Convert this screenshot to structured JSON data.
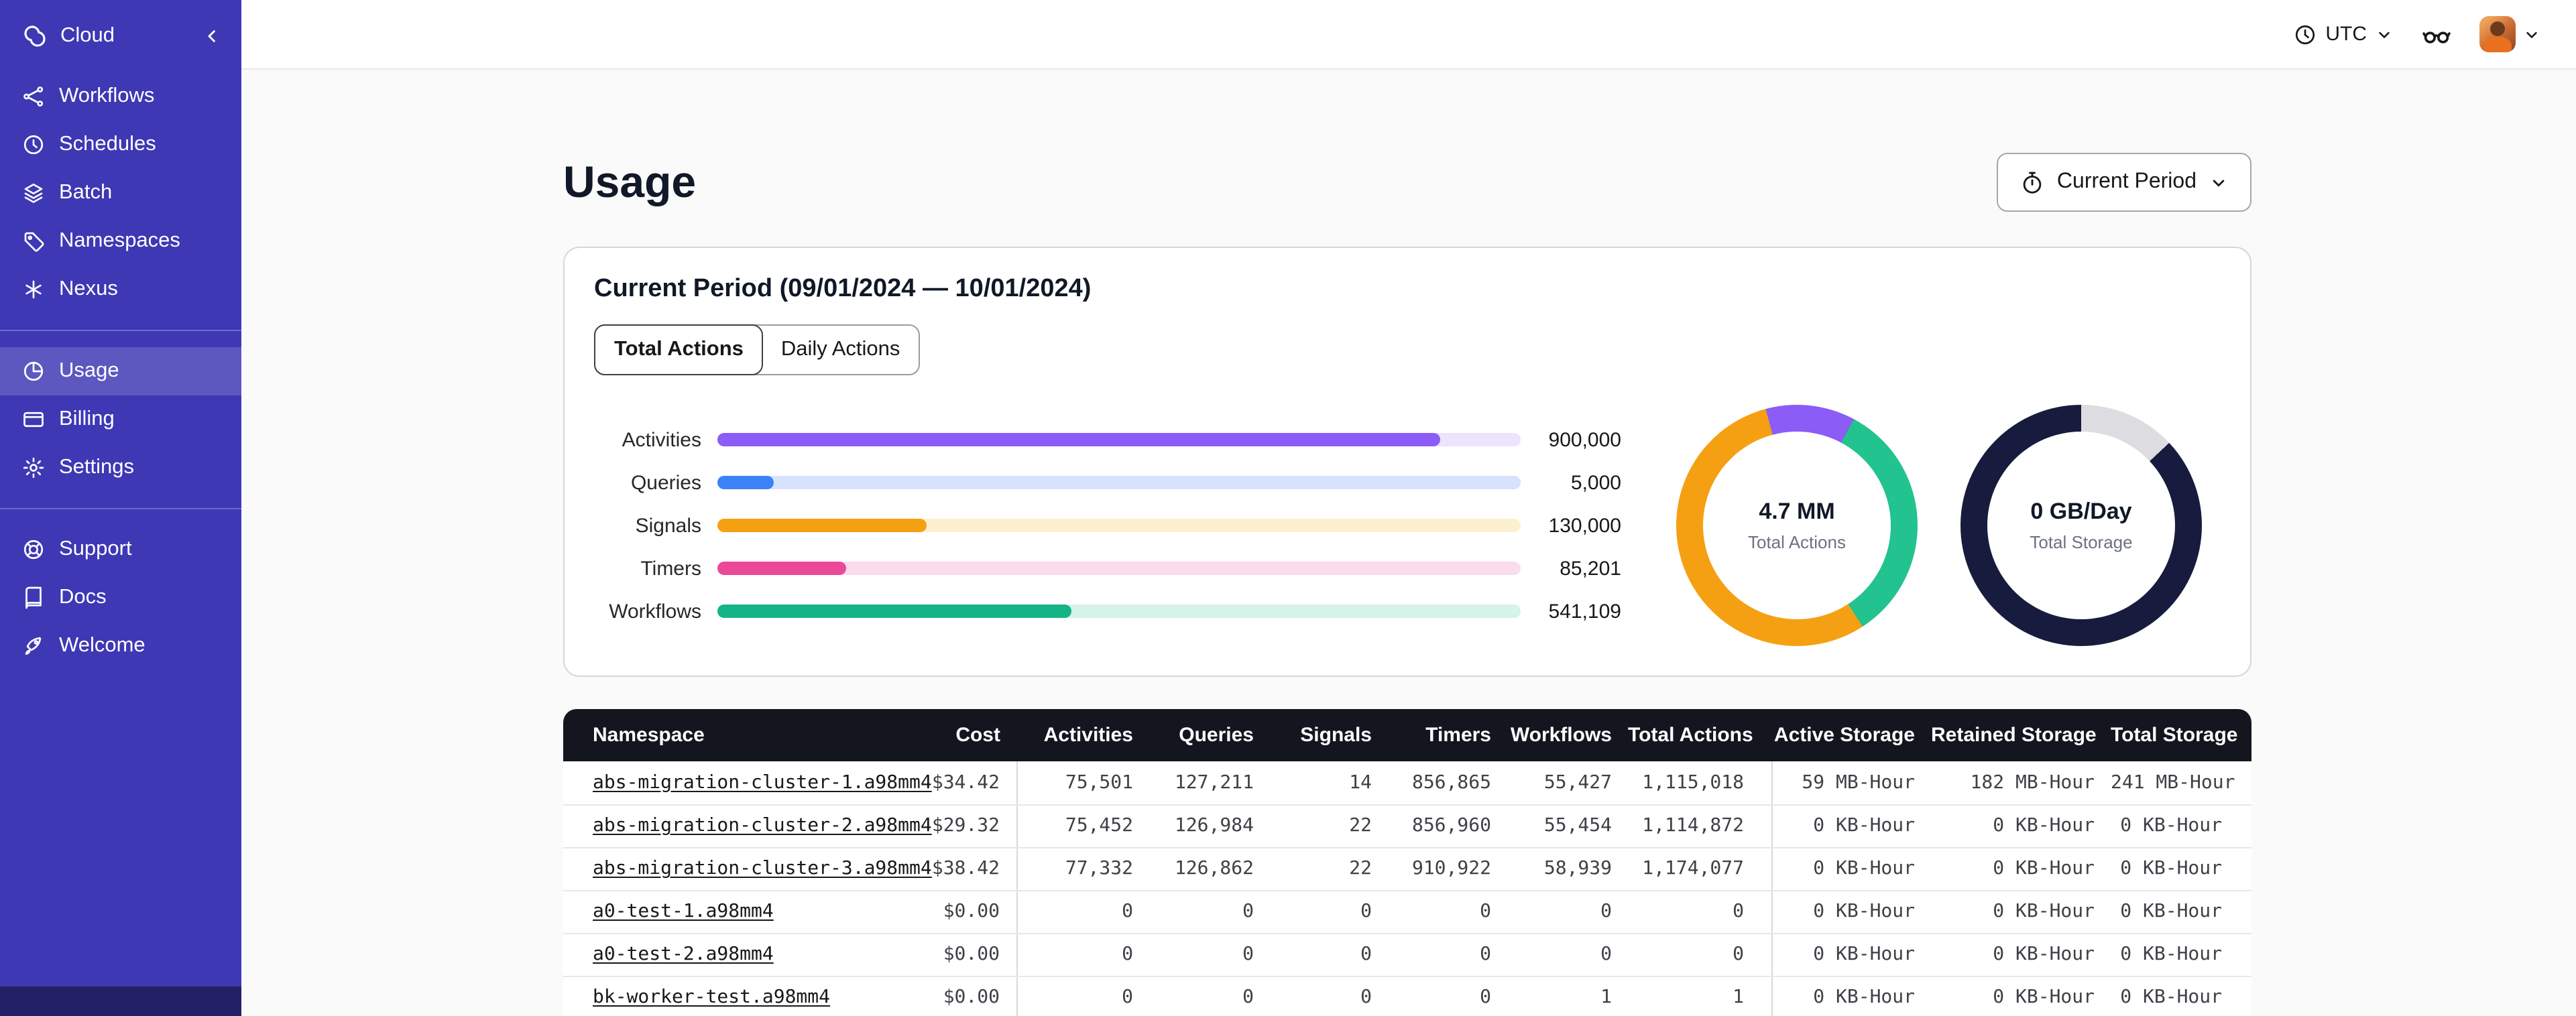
{
  "colors": {
    "sidebar": "#3e38b4",
    "sidebar_footer": "#232066",
    "table_header": "#14161f"
  },
  "sidebar": {
    "brand": {
      "label": "Cloud",
      "icon": "temporal-logo-icon"
    },
    "nav_main": [
      {
        "label": "Workflows",
        "icon": "workflows-icon"
      },
      {
        "label": "Schedules",
        "icon": "schedules-icon"
      },
      {
        "label": "Batch",
        "icon": "batch-icon"
      },
      {
        "label": "Namespaces",
        "icon": "namespaces-icon"
      },
      {
        "label": "Nexus",
        "icon": "nexus-icon"
      }
    ],
    "nav_account": [
      {
        "label": "Usage",
        "icon": "usage-icon",
        "active": true
      },
      {
        "label": "Billing",
        "icon": "billing-icon",
        "active": false
      },
      {
        "label": "Settings",
        "icon": "settings-icon",
        "active": false
      }
    ],
    "nav_help": [
      {
        "label": "Support",
        "icon": "support-icon"
      },
      {
        "label": "Docs",
        "icon": "docs-icon"
      },
      {
        "label": "Welcome",
        "icon": "welcome-icon"
      }
    ]
  },
  "topbar": {
    "timezone": "UTC"
  },
  "page": {
    "title": "Usage",
    "period_selector": "Current Period"
  },
  "card": {
    "title": "Current Period (09/01/2024 — 10/01/2024)",
    "tabs": [
      {
        "label": "Total Actions",
        "active": true
      },
      {
        "label": "Daily Actions",
        "active": false
      }
    ]
  },
  "chart_data": [
    {
      "type": "bar",
      "orientation": "horizontal",
      "categories": [
        "Activities",
        "Queries",
        "Signals",
        "Timers",
        "Workflows"
      ],
      "values": [
        900000,
        5000,
        130000,
        85201,
        541109
      ],
      "value_labels": [
        "900,000",
        "5,000",
        "130,000",
        "85,201",
        "541,109"
      ],
      "fill_percents": [
        90,
        7,
        26,
        16,
        44
      ],
      "colors": [
        "#8b5cf6",
        "#3b82f6",
        "#f5a013",
        "#ec4899",
        "#14b487"
      ],
      "track_colors": [
        "#ece4fd",
        "#d7e3fd",
        "#fdf0cf",
        "#fbdcee",
        "#d5f3e6"
      ]
    },
    {
      "type": "pie",
      "title": "Total Actions donut",
      "center_value": "4.7 MM",
      "center_label": "Total Actions",
      "slices": [
        {
          "name": "purple-segment",
          "percent": 12,
          "color": "#8b5cf6"
        },
        {
          "name": "green-segment",
          "percent": 33,
          "color": "#22c38e"
        },
        {
          "name": "orange-segment",
          "percent": 55,
          "color": "#f5a013"
        }
      ]
    },
    {
      "type": "pie",
      "title": "Total Storage donut",
      "center_value": "0 GB/Day",
      "center_label": "Total Storage",
      "slices": [
        {
          "name": "light-segment",
          "percent": 13,
          "color": "#dcdce1"
        },
        {
          "name": "navy-segment",
          "percent": 87,
          "color": "#171b3d"
        }
      ]
    }
  ],
  "table": {
    "columns": [
      "Namespace",
      "Cost",
      "Activities",
      "Queries",
      "Signals",
      "Timers",
      "Workflows",
      "Total Actions",
      "Active Storage",
      "Retained Storage",
      "Total Storage"
    ],
    "rows": [
      [
        "abs-migration-cluster-1.a98mm4",
        "$34.42",
        "75,501",
        "127,211",
        "14",
        "856,865",
        "55,427",
        "1,115,018",
        "59 MB-Hour",
        "182 MB-Hour",
        "241 MB-Hour"
      ],
      [
        "abs-migration-cluster-2.a98mm4",
        "$29.32",
        "75,452",
        "126,984",
        "22",
        "856,960",
        "55,454",
        "1,114,872",
        "0 KB-Hour",
        "0 KB-Hour",
        "0 KB-Hour"
      ],
      [
        "abs-migration-cluster-3.a98mm4",
        "$38.42",
        "77,332",
        "126,862",
        "22",
        "910,922",
        "58,939",
        "1,174,077",
        "0 KB-Hour",
        "0 KB-Hour",
        "0 KB-Hour"
      ],
      [
        "a0-test-1.a98mm4",
        "$0.00",
        "0",
        "0",
        "0",
        "0",
        "0",
        "0",
        "0 KB-Hour",
        "0 KB-Hour",
        "0 KB-Hour"
      ],
      [
        "a0-test-2.a98mm4",
        "$0.00",
        "0",
        "0",
        "0",
        "0",
        "0",
        "0",
        "0 KB-Hour",
        "0 KB-Hour",
        "0 KB-Hour"
      ],
      [
        "bk-worker-test.a98mm4",
        "$0.00",
        "0",
        "0",
        "0",
        "0",
        "1",
        "1",
        "0 KB-Hour",
        "0 KB-Hour",
        "0 KB-Hour"
      ]
    ]
  }
}
